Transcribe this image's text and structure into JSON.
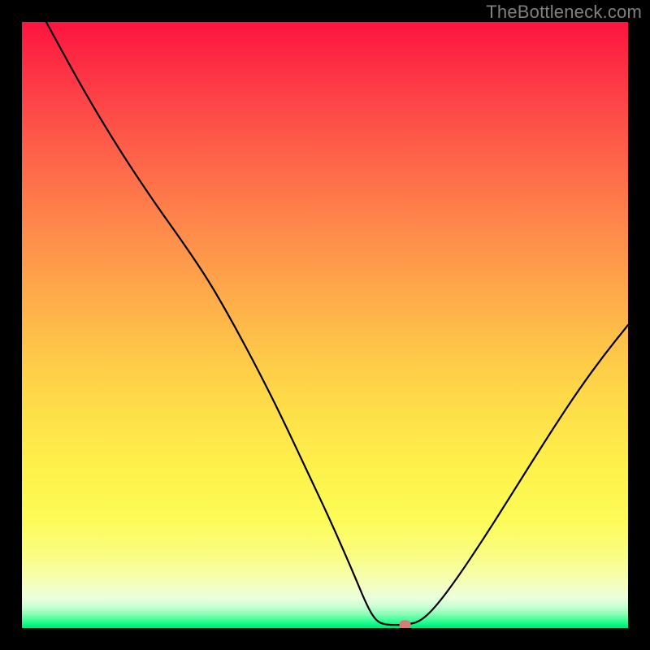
{
  "watermark": "TheBottleneck.com",
  "chart_data": {
    "type": "line",
    "title": "",
    "xlabel": "",
    "ylabel": "",
    "xlim": [
      0,
      100
    ],
    "ylim": [
      0,
      100
    ],
    "grid": false,
    "legend": false,
    "series": [
      {
        "name": "bottleneck-curve",
        "stroke": "#000000",
        "points": [
          {
            "x": 4.0,
            "y": 100.0
          },
          {
            "x": 10.0,
            "y": 89.0
          },
          {
            "x": 16.0,
            "y": 79.0
          },
          {
            "x": 22.0,
            "y": 70.0
          },
          {
            "x": 27.0,
            "y": 63.0
          },
          {
            "x": 31.0,
            "y": 57.0
          },
          {
            "x": 35.0,
            "y": 50.0
          },
          {
            "x": 39.0,
            "y": 42.5
          },
          {
            "x": 43.0,
            "y": 34.5
          },
          {
            "x": 47.0,
            "y": 26.0
          },
          {
            "x": 51.0,
            "y": 17.5
          },
          {
            "x": 54.5,
            "y": 9.5
          },
          {
            "x": 57.0,
            "y": 3.5
          },
          {
            "x": 58.5,
            "y": 1.1
          },
          {
            "x": 60.0,
            "y": 0.55
          },
          {
            "x": 62.0,
            "y": 0.5
          },
          {
            "x": 64.0,
            "y": 0.6
          },
          {
            "x": 66.0,
            "y": 1.3
          },
          {
            "x": 68.5,
            "y": 3.8
          },
          {
            "x": 72.0,
            "y": 8.5
          },
          {
            "x": 76.0,
            "y": 14.5
          },
          {
            "x": 80.0,
            "y": 20.8
          },
          {
            "x": 84.0,
            "y": 27.2
          },
          {
            "x": 88.0,
            "y": 33.5
          },
          {
            "x": 92.0,
            "y": 39.5
          },
          {
            "x": 96.0,
            "y": 45.0
          },
          {
            "x": 100.0,
            "y": 50.0
          }
        ]
      }
    ],
    "marker": {
      "name": "optimal-point",
      "x": 63.2,
      "y": 0.55,
      "color": "#d77a7a"
    }
  }
}
